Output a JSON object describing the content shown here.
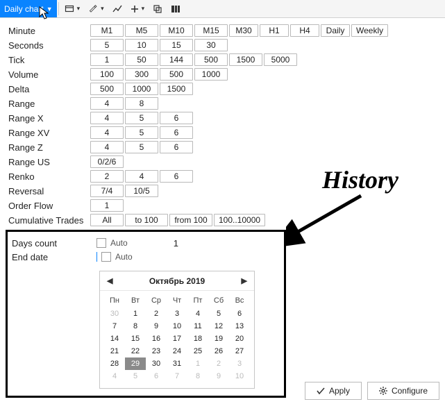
{
  "toolbar": {
    "chart_dropdown_label": "Daily chart"
  },
  "rows": [
    {
      "label": "Minute",
      "opts": [
        "M1",
        "M5",
        "M10",
        "M15",
        "M30",
        "H1",
        "H4",
        "Daily",
        "Weekly"
      ]
    },
    {
      "label": "Seconds",
      "opts": [
        "5",
        "10",
        "15",
        "30"
      ]
    },
    {
      "label": "Tick",
      "opts": [
        "1",
        "50",
        "144",
        "500",
        "1500",
        "5000"
      ]
    },
    {
      "label": "Volume",
      "opts": [
        "100",
        "300",
        "500",
        "1000"
      ]
    },
    {
      "label": "Delta",
      "opts": [
        "500",
        "1000",
        "1500"
      ]
    },
    {
      "label": "Range",
      "opts": [
        "4",
        "8"
      ]
    },
    {
      "label": "Range X",
      "opts": [
        "4",
        "5",
        "6"
      ]
    },
    {
      "label": "Range XV",
      "opts": [
        "4",
        "5",
        "6"
      ]
    },
    {
      "label": "Range Z",
      "opts": [
        "4",
        "5",
        "6"
      ]
    },
    {
      "label": "Range US",
      "opts": [
        "0/2/6"
      ]
    },
    {
      "label": "Renko",
      "opts": [
        "2",
        "4",
        "6"
      ]
    },
    {
      "label": "Reversal",
      "opts": [
        "7/4",
        "10/5"
      ]
    },
    {
      "label": "Order Flow",
      "opts": [
        "1"
      ]
    },
    {
      "label": "Cumulative Trades",
      "opts": [
        "All",
        "to 100",
        "from 100",
        "100..10000"
      ]
    }
  ],
  "history": {
    "days_count_label": "Days count",
    "days_count_auto": "Auto",
    "days_count_value": "1",
    "end_date_label": "End date",
    "end_date_auto": "Auto"
  },
  "calendar": {
    "title": "Октябрь 2019",
    "dow": [
      "Пн",
      "Вт",
      "Ср",
      "Чт",
      "Пт",
      "Сб",
      "Вс"
    ],
    "days": [
      {
        "n": "30",
        "out": true
      },
      {
        "n": "1"
      },
      {
        "n": "2"
      },
      {
        "n": "3"
      },
      {
        "n": "4"
      },
      {
        "n": "5"
      },
      {
        "n": "6"
      },
      {
        "n": "7"
      },
      {
        "n": "8"
      },
      {
        "n": "9"
      },
      {
        "n": "10"
      },
      {
        "n": "11"
      },
      {
        "n": "12"
      },
      {
        "n": "13"
      },
      {
        "n": "14"
      },
      {
        "n": "15"
      },
      {
        "n": "16"
      },
      {
        "n": "17"
      },
      {
        "n": "18"
      },
      {
        "n": "19"
      },
      {
        "n": "20"
      },
      {
        "n": "21"
      },
      {
        "n": "22"
      },
      {
        "n": "23"
      },
      {
        "n": "24"
      },
      {
        "n": "25"
      },
      {
        "n": "26"
      },
      {
        "n": "27"
      },
      {
        "n": "28"
      },
      {
        "n": "29",
        "sel": true
      },
      {
        "n": "30"
      },
      {
        "n": "31"
      },
      {
        "n": "1",
        "out": true
      },
      {
        "n": "2",
        "out": true
      },
      {
        "n": "3",
        "out": true
      },
      {
        "n": "4",
        "out": true
      },
      {
        "n": "5",
        "out": true
      },
      {
        "n": "6",
        "out": true
      },
      {
        "n": "7",
        "out": true
      },
      {
        "n": "8",
        "out": true
      },
      {
        "n": "9",
        "out": true
      },
      {
        "n": "10",
        "out": true
      }
    ]
  },
  "footer": {
    "apply": "Apply",
    "configure": "Configure"
  },
  "annotation": {
    "label": "History"
  }
}
